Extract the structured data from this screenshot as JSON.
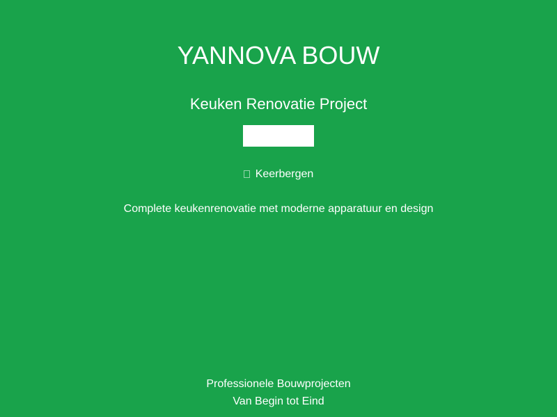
{
  "brand": {
    "name": "YANNOVA BOUW"
  },
  "project": {
    "title": "Keuken Renovatie Project",
    "location": "Keerbergen",
    "location_icon": "map-pin-icon",
    "description": "Complete keukenrenovatie met moderne apparatuur en design"
  },
  "footer": {
    "line1": "Professionele Bouwprojecten",
    "line2": "Van Begin tot Eind"
  },
  "colors": {
    "background": "#19a34b",
    "text": "#ffffff"
  }
}
